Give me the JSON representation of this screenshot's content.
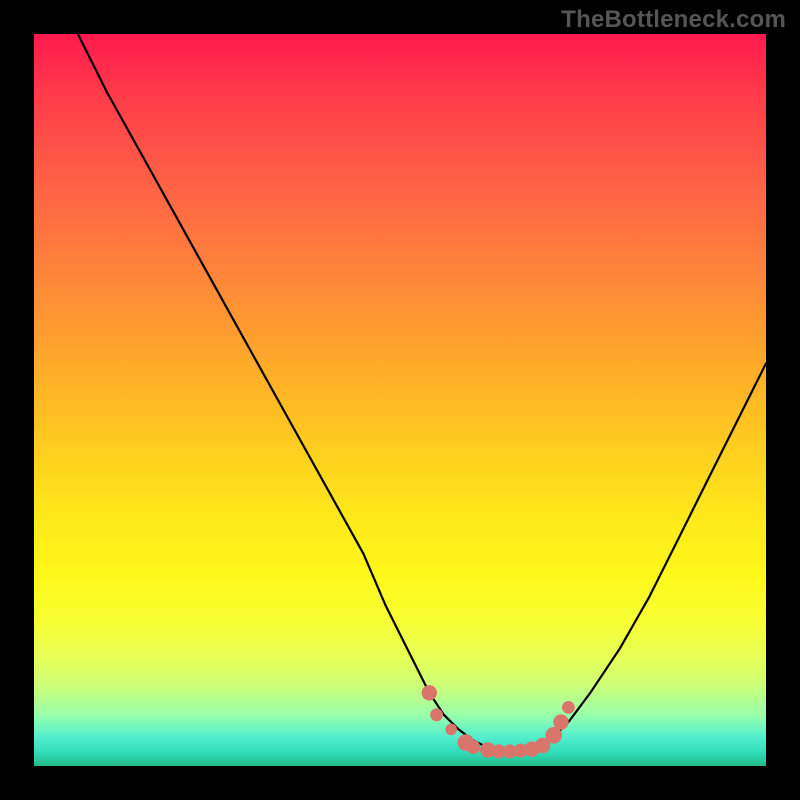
{
  "watermark": "TheBottleneck.com",
  "chart_data": {
    "type": "line",
    "title": "",
    "xlabel": "",
    "ylabel": "",
    "xlim": [
      0,
      100
    ],
    "ylim": [
      0,
      100
    ],
    "grid": false,
    "series": [
      {
        "name": "curve",
        "x": [
          6,
          10,
          15,
          20,
          25,
          30,
          35,
          40,
          45,
          48,
          51,
          54,
          56,
          58,
          60,
          62,
          64,
          66,
          68,
          70,
          73,
          76,
          80,
          84,
          88,
          92,
          96,
          100
        ],
        "values": [
          100,
          92,
          83,
          74,
          65,
          56,
          47,
          38,
          29,
          22,
          16,
          10,
          7,
          5,
          3.5,
          2.5,
          2,
          2,
          2.2,
          3,
          6,
          10,
          16,
          23,
          31,
          39,
          47,
          55
        ]
      }
    ],
    "scatter_overlay": {
      "name": "dots",
      "color": "#d9756b",
      "points": [
        {
          "x": 54,
          "y": 10,
          "r": 2.4
        },
        {
          "x": 55,
          "y": 7,
          "r": 2.0
        },
        {
          "x": 57,
          "y": 5,
          "r": 1.8
        },
        {
          "x": 59,
          "y": 3.2,
          "r": 2.6
        },
        {
          "x": 60,
          "y": 2.6,
          "r": 2.2
        },
        {
          "x": 62,
          "y": 2.2,
          "r": 2.4
        },
        {
          "x": 63.5,
          "y": 2.0,
          "r": 2.2
        },
        {
          "x": 65,
          "y": 2.0,
          "r": 2.2
        },
        {
          "x": 66.5,
          "y": 2.1,
          "r": 2.2
        },
        {
          "x": 68,
          "y": 2.3,
          "r": 2.4
        },
        {
          "x": 69.5,
          "y": 2.8,
          "r": 2.4
        },
        {
          "x": 71,
          "y": 4.2,
          "r": 2.6
        },
        {
          "x": 72,
          "y": 6.0,
          "r": 2.4
        },
        {
          "x": 73,
          "y": 8.0,
          "r": 2.0
        }
      ]
    }
  }
}
